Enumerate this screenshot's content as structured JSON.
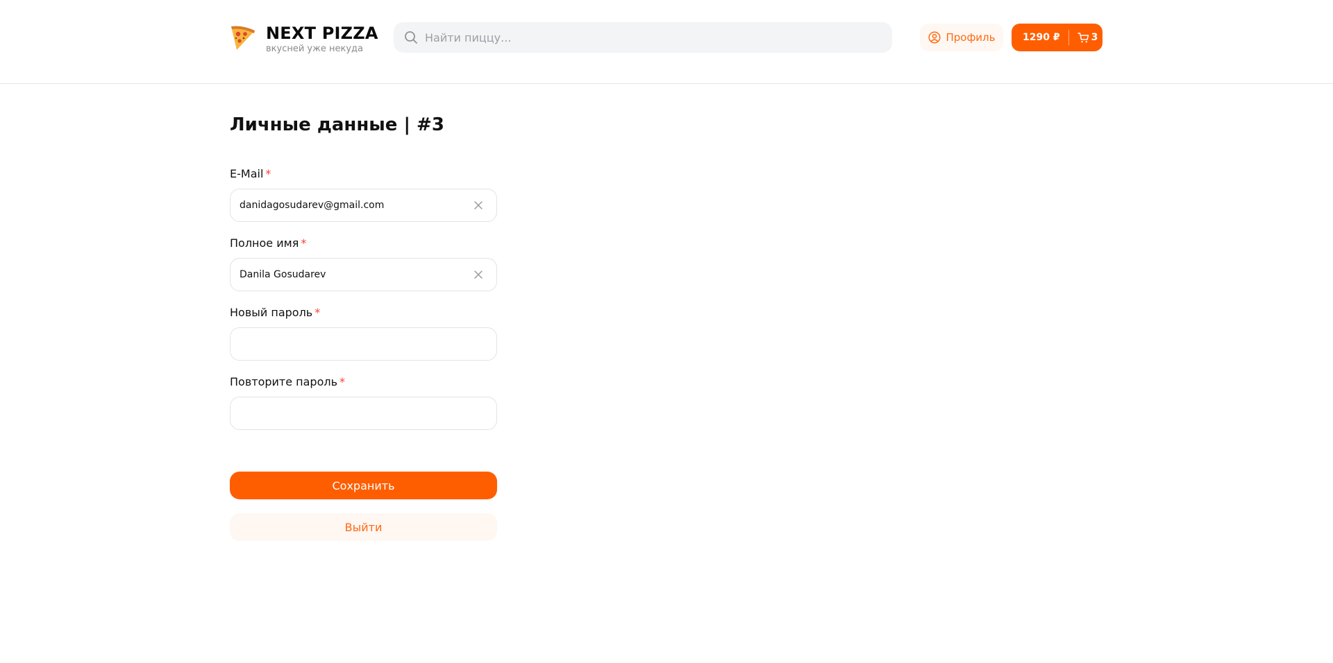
{
  "header": {
    "logo": {
      "title": "NEXT PIZZA",
      "subtitle": "вкусней уже некуда",
      "icon": "pizza-slice-icon"
    },
    "search": {
      "placeholder": "Найти пиццу...",
      "value": "",
      "icon": "search-icon"
    },
    "profile_button": {
      "label": "Профиль",
      "icon": "user-circle-icon"
    },
    "cart_button": {
      "price": "1290 ₽",
      "count": "3",
      "icon": "cart-icon"
    }
  },
  "page": {
    "title": "Личные данные | #3"
  },
  "form": {
    "email": {
      "label": "E-Mail",
      "required_mark": "*",
      "value": "danidagosudarev@gmail.com"
    },
    "full_name": {
      "label": "Полное имя",
      "required_mark": "*",
      "value": "Danila Gosudarev"
    },
    "new_password": {
      "label": "Новый пароль",
      "required_mark": "*",
      "value": ""
    },
    "repeat_password": {
      "label": "Повторите пароль",
      "required_mark": "*",
      "value": ""
    },
    "save_label": "Сохранить",
    "logout_label": "Выйти"
  },
  "colors": {
    "accent": "#ff5e00",
    "accent_soft": "#fff7f2",
    "required": "#ff3b30",
    "search_bg": "#f3f4f6"
  }
}
